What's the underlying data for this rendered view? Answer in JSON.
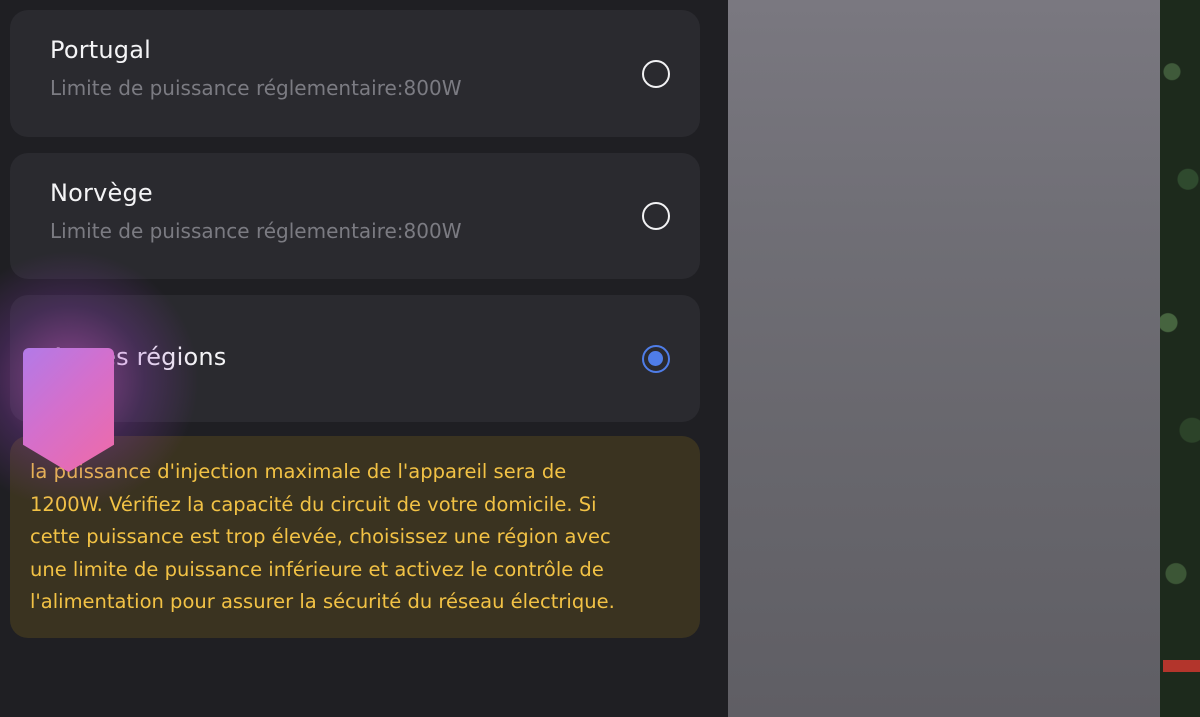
{
  "regions": [
    {
      "name": "Portugal",
      "limit": "Limite de puissance réglementaire:800W",
      "selected": false
    },
    {
      "name": "Norvège",
      "limit": "Limite de puissance réglementaire:800W",
      "selected": false
    },
    {
      "name": "Autres régions",
      "selected": true
    }
  ],
  "warning": {
    "lines": [
      "la puissance d'injection maximale de l'appareil sera de",
      "1200W. Vérifiez la capacité du circuit de votre domicile. Si",
      "cette puissance est trop élevée, choisissez une région avec",
      "une limite de puissance inférieure et activez le contrôle de",
      "l'alimentation pour assurer la sécurité du réseau électrique."
    ]
  },
  "colors": {
    "accent": "#4f7de8",
    "warning_text": "#f2c245",
    "card_bg": "#2a2a2f",
    "screen_bg": "#1f1f23"
  },
  "icons": {
    "radio_unselected": "radio-outline",
    "radio_selected": "radio-filled",
    "overlay_marker": "pointer-marker"
  }
}
